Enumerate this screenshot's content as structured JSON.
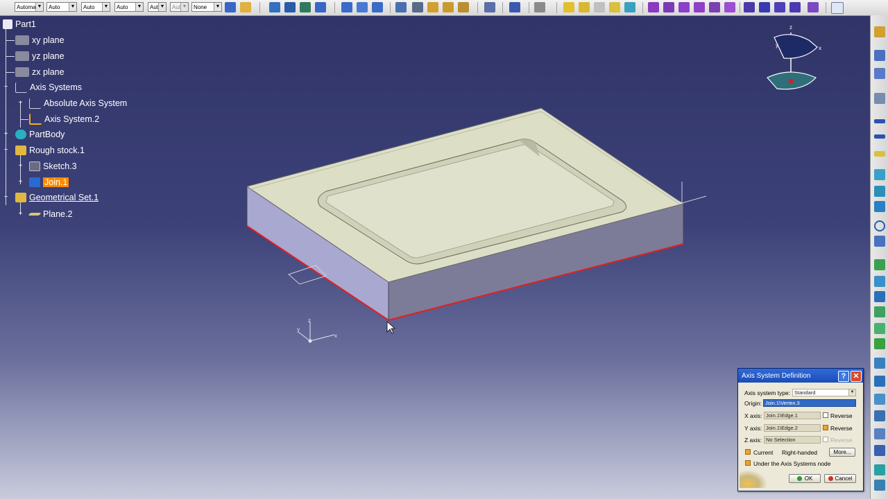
{
  "toolbar": {
    "combos": [
      {
        "value": "Automa"
      },
      {
        "value": "Auto"
      },
      {
        "value": "Auto"
      },
      {
        "value": "Auto"
      },
      {
        "value": "Aut"
      },
      {
        "value": "Aut"
      },
      {
        "value": "None"
      }
    ]
  },
  "tree": {
    "root": "Part1",
    "xy_plane": "xy plane",
    "yz_plane": "yz plane",
    "zx_plane": "zx plane",
    "axis_systems": "Axis Systems",
    "absolute_axis": "Absolute Axis System",
    "axis_system_2": "Axis System.2",
    "partbody": "PartBody",
    "rough_stock": "Rough stock.1",
    "sketch3": "Sketch.3",
    "join1": "Join.1",
    "geo_set": "Geometrical Set.1",
    "plane2": "Plane.2"
  },
  "compass": {
    "z": "z",
    "y": "y",
    "x": "x"
  },
  "triad": {
    "z": "z",
    "y": "y",
    "x": "x"
  },
  "dialog": {
    "title": "Axis System Definition",
    "help": "?",
    "close": "✕",
    "type_label": "Axis system type:",
    "type_value": "Standard",
    "origin_label": "Origin:",
    "origin_value": "Join.1\\Vertex.3",
    "x_label": "X axis:",
    "x_value": "Join.1\\Edge.1",
    "y_label": "Y axis:",
    "y_value": "Join.1\\Edge.2",
    "z_label": "Z axis:",
    "z_value": "No Selection",
    "reverse": "Reverse",
    "current": "Current",
    "right_handed": "Right-handed",
    "more": "More...",
    "under_node": "Under the Axis Systems node",
    "ok": "OK",
    "cancel": "Cancel"
  },
  "colors": {
    "background_top": "#2f3366",
    "background_bottom": "#c9cbdc",
    "part_top": "#dadcc4",
    "part_side": "#a6a6cc",
    "selected_edge": "#e02020",
    "tree_selected": "#ff8a00"
  }
}
